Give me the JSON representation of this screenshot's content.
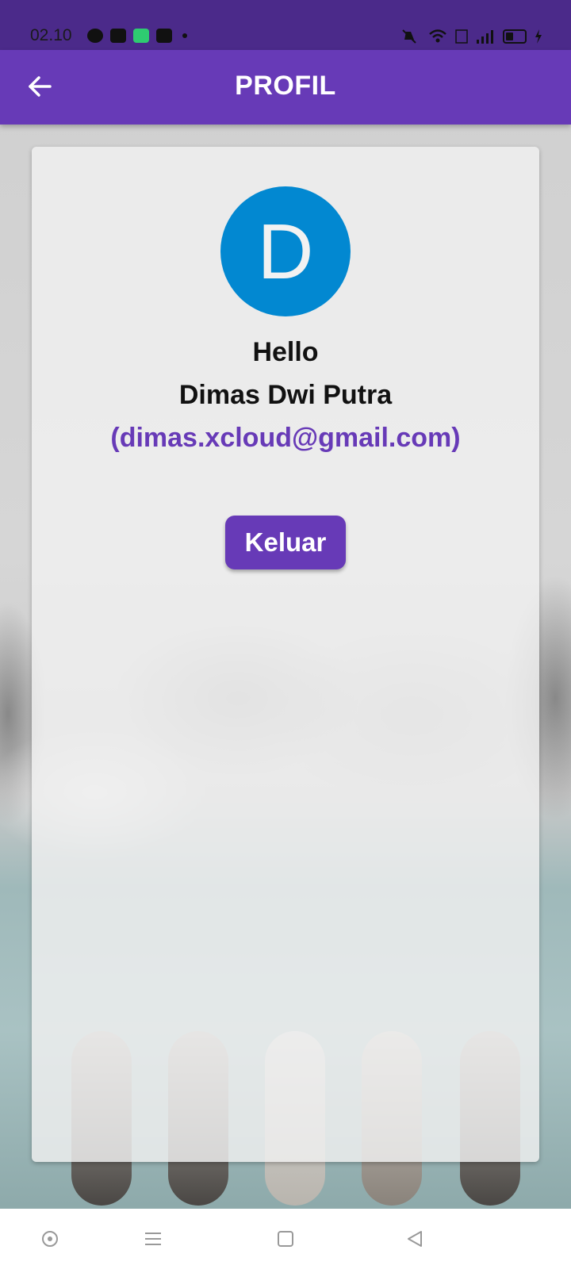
{
  "status_bar": {
    "time": "02.10",
    "left_icons": [
      "whatsapp-icon",
      "youtube-icon",
      "battery-saver-icon",
      "facebook-icon",
      "dot-icon"
    ],
    "right_icons": [
      "mute-icon",
      "wifi-icon",
      "volte-icon",
      "signal-icon",
      "battery-icon",
      "charging-icon"
    ]
  },
  "app_bar": {
    "title": "PROFIL",
    "back_icon": "arrow-left-icon"
  },
  "profile": {
    "avatar_letter": "D",
    "greeting": "Hello",
    "name": "Dimas Dwi Putra",
    "email": "(dimas.xcloud@gmail.com)",
    "logout_label": "Keluar"
  },
  "nav_bar": {
    "icons": [
      "assistant-icon",
      "menu-icon",
      "home-icon",
      "back-icon"
    ]
  },
  "colors": {
    "primary": "#673ab7",
    "status_bar": "#4b2a8a",
    "avatar": "#0288d1"
  }
}
